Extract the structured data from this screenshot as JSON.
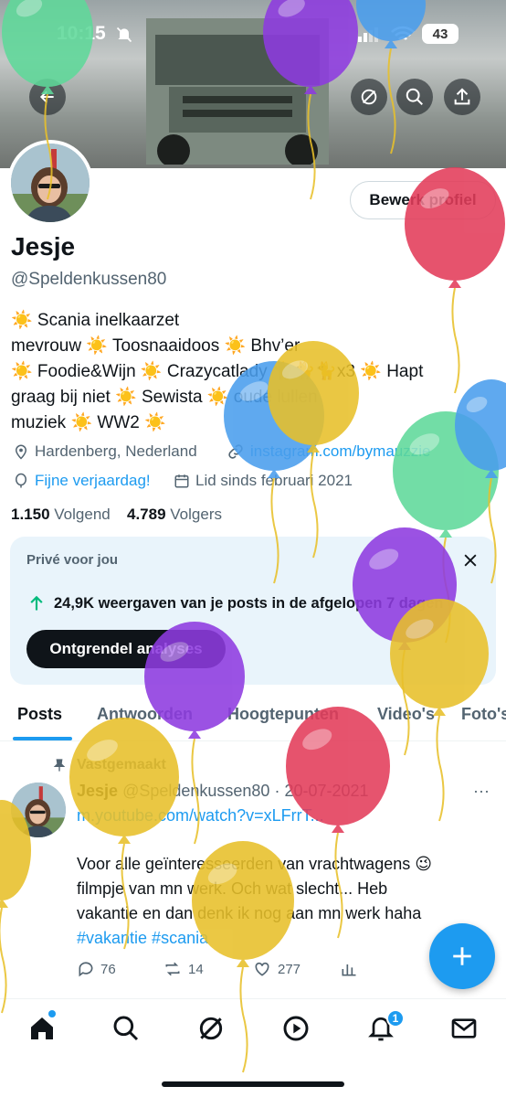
{
  "status_bar": {
    "time": "10:15",
    "battery": "43"
  },
  "profile": {
    "name": "Jesje",
    "handle": "@Speldenkussen80",
    "edit_label": "Bewerk profiel",
    "bio_lines": [
      "☀️ Scania inelkaarzet",
      "mevrouw ☀️ Toosnaaidoos ☀️ Bhv’er",
      "☀️ Foodie&Wijn ☀️ Crazycatlady 🐈🐈🐈x3 ☀️ Hapt",
      "graag bij niet ☀️ Sewista ☀️ oude lullen",
      "muziek ☀️ WW2 ☀️"
    ],
    "location": "Hardenberg, Nederland",
    "website": "instagram.com/bymauzzie",
    "birthday": "Fijne verjaardag!",
    "joined": "Lid sinds februari 2021",
    "following_count": "1.150",
    "following_label": "Volgend",
    "followers_count": "4.789",
    "followers_label": "Volgers"
  },
  "private_card": {
    "title": "Privé voor jou",
    "stat": "24,9K weergaven van je posts in de afgelopen 7 dagen",
    "button": "Ontgrendel analyses"
  },
  "tabs": [
    "Posts",
    "Antwoorden",
    "Hoogtepunten",
    "Video's",
    "Foto's"
  ],
  "post": {
    "pinned_label": "Vastgemaakt",
    "author": "Jesje",
    "handle": "@Speldenkussen80",
    "date": "· 20-07-2021",
    "link": "m.youtube.com/watch?v=xLFrrT...",
    "text_lines": [
      "Voor alle geïnteresseerden van vrachtwagens 😉",
      "filmpje van mn werk. Och wat slecht... Heb",
      "vakantie en dan denk ik nog aan mn werk haha"
    ],
    "hashtags": "#vakantie #scania",
    "replies": "76",
    "reposts": "14",
    "likes": "277"
  },
  "notifications_badge": "1",
  "balloon_colors": [
    "#5fd99a",
    "#8e3be0",
    "#4a9eed",
    "#e33c5a",
    "#e8c02a"
  ]
}
